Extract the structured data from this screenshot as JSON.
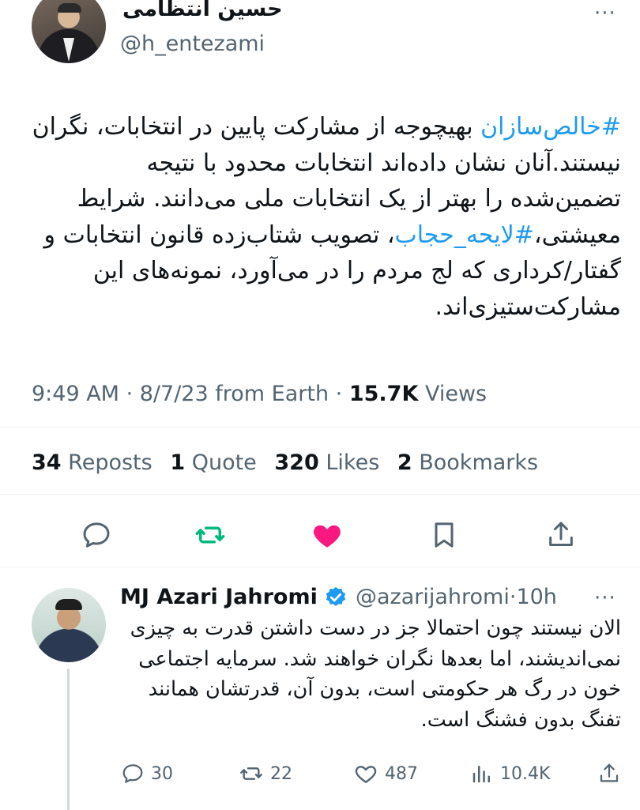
{
  "tweet": {
    "author_name": "حسین انتظامی",
    "author_handle": "@h_entezami",
    "hashtag_1": "#خالص‌سازان",
    "text_part_1": " بهیچوجه از مشارکت پایین در انتخابات، نگران نیستند.آنان نشان داده‌اند انتخابات محدود با نتیجه تضمین‌شده را بهتر از یک انتخابات ملی می‌دانند. شرایط معیشتی،",
    "hashtag_2": "#لایحه_حجاب",
    "text_part_2": "، تصویب شتاب‌زده قانون انتخابات و گفتار/کرداری که لج مردم را در می‌آورد، نمونه‌های این مشارکت‌ستیزی‌اند.",
    "time": "9:49 AM",
    "date": "8/7/23",
    "source": "from Earth",
    "views_count": "15.7K",
    "views_label": "Views",
    "more": "···"
  },
  "stats": {
    "reposts_count": "34",
    "reposts_label": "Reposts",
    "quotes_count": "1",
    "quotes_label": "Quote",
    "likes_count": "320",
    "likes_label": "Likes",
    "bookmarks_count": "2",
    "bookmarks_label": "Bookmarks"
  },
  "actions": [
    "reply-icon",
    "repost-icon",
    "like-icon",
    "bookmark-icon",
    "share-icon"
  ],
  "colors": {
    "accent": "#1d9bf0",
    "repost_green": "#00ba7c",
    "like_pink": "#f91880",
    "muted": "#536471"
  },
  "reply": {
    "author_name": "MJ Azari Jahromi",
    "author_handle": "@azarijahromi",
    "time_ago": "10h",
    "separator": "·",
    "more": "···",
    "text": "الان نیستند چون احتمالا جز در دست داشتن قدرت به چیزی نمی‌اندیشند، اما بعدها نگران خواهند شد. سرمایه اجتماعی خون در رگ هر حکومتی است، بدون آن، قدرتشان همانند تفنگ بدون فشنگ است.",
    "replies": "30",
    "reposts": "22",
    "likes": "487",
    "views": "10.4K"
  }
}
